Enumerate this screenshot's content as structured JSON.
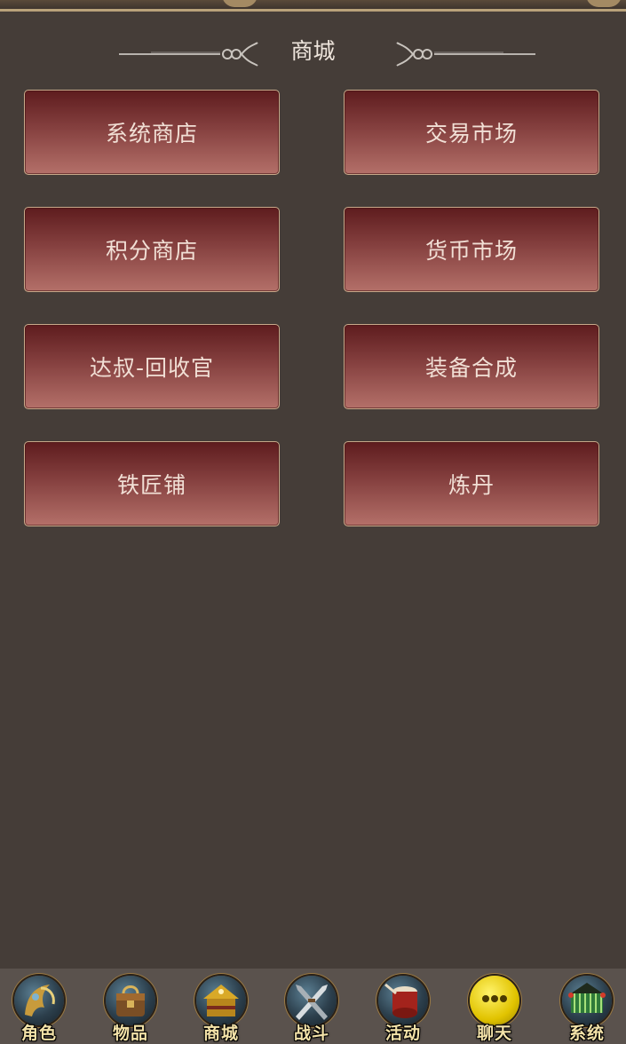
{
  "header": {
    "title": "商城"
  },
  "menu": {
    "buttons": [
      {
        "label": "系统商店"
      },
      {
        "label": "交易市场"
      },
      {
        "label": "积分商店"
      },
      {
        "label": "货币市场"
      },
      {
        "label": "达叔-回收官"
      },
      {
        "label": "装备合成"
      },
      {
        "label": "铁匠铺"
      },
      {
        "label": "炼丹"
      }
    ]
  },
  "bottom_nav": {
    "items": [
      {
        "label": "角色",
        "icon": "character-icon"
      },
      {
        "label": "物品",
        "icon": "items-icon"
      },
      {
        "label": "商城",
        "icon": "shop-icon"
      },
      {
        "label": "战斗",
        "icon": "battle-icon"
      },
      {
        "label": "活动",
        "icon": "activity-icon"
      },
      {
        "label": "聊天",
        "icon": "chat-icon"
      },
      {
        "label": "系统",
        "icon": "system-icon"
      }
    ]
  },
  "colors": {
    "background": "#453d38",
    "button_top": "#5e1c1e",
    "button_bottom": "#b47069",
    "button_border": "#c8a98a",
    "nav_bar": "#5a524d",
    "nav_label": "#f3e2a8"
  }
}
